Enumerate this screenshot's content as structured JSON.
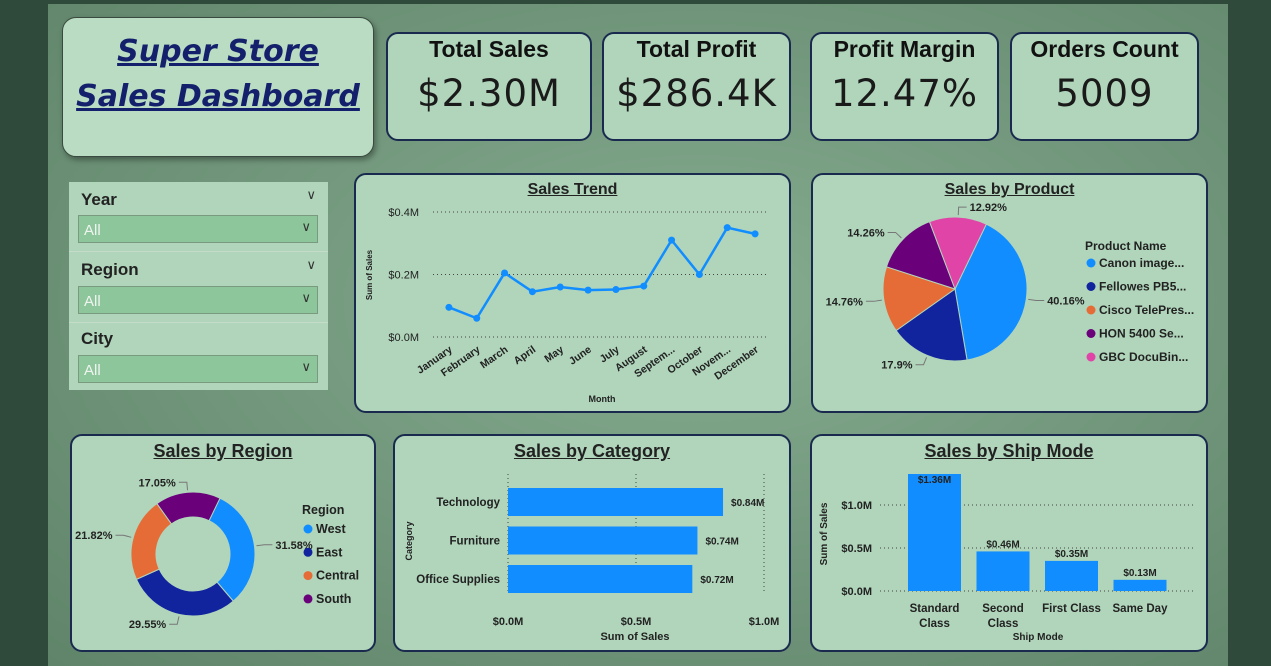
{
  "dashboard": {
    "title_line1": "Super Store ",
    "title_line2": "Sales Dashboard"
  },
  "kpis": [
    {
      "label": "Total Sales",
      "value": "$2.30M"
    },
    {
      "label": "Total Profit",
      "value": "$286.4K"
    },
    {
      "label": "Profit Margin",
      "value": "12.47%"
    },
    {
      "label": "Orders Count",
      "value": "5009"
    }
  ],
  "slicers": [
    {
      "label": "Year",
      "value": "All"
    },
    {
      "label": "Region",
      "value": "All"
    },
    {
      "label": "City",
      "value": "All"
    }
  ],
  "colors": {
    "accent": "#118dff",
    "navy": "#12239e",
    "orange": "#e66c37",
    "purple": "#6b007b",
    "pink": "#e044a7",
    "card_bg": "#b0d5bb",
    "card_border": "#1a2a4e"
  },
  "chart_data": [
    {
      "id": "sales_trend",
      "type": "line",
      "title": "Sales Trend",
      "xlabel": "Month",
      "ylabel": "Sum of Sales",
      "categories": [
        "January",
        "February",
        "March",
        "April",
        "May",
        "June",
        "July",
        "August",
        "Septem...",
        "October",
        "Novem...",
        "December"
      ],
      "values": [
        0.095,
        0.06,
        0.205,
        0.145,
        0.16,
        0.15,
        0.152,
        0.163,
        0.31,
        0.2,
        0.35,
        0.33
      ],
      "ylim": [
        0,
        0.4
      ],
      "y_ticks": [
        "$0.0M",
        "$0.2M",
        "$0.4M"
      ],
      "grid": true
    },
    {
      "id": "sales_by_product",
      "type": "pie",
      "title": "Sales by Product",
      "legend_title": "Product Name",
      "legend_position": "right",
      "slices": [
        {
          "name": "Canon image...",
          "value": 40.16,
          "label": "40.16%",
          "color": "#118dff"
        },
        {
          "name": "Fellowes PB5...",
          "value": 17.9,
          "label": "17.9%",
          "color": "#12239e"
        },
        {
          "name": "Cisco TelePres...",
          "value": 14.76,
          "label": "14.76%",
          "color": "#e66c37"
        },
        {
          "name": "HON 5400 Se...",
          "value": 14.26,
          "label": "14.26%",
          "color": "#6b007b"
        },
        {
          "name": "GBC DocuBin...",
          "value": 12.92,
          "label": "12.92%",
          "color": "#e044a7"
        }
      ]
    },
    {
      "id": "sales_by_region",
      "type": "pie",
      "title": "Sales by Region",
      "legend_title": "Region",
      "legend_position": "right",
      "donut": true,
      "slices": [
        {
          "name": "West",
          "value": 31.58,
          "label": "31.58%",
          "color": "#118dff"
        },
        {
          "name": "East",
          "value": 29.55,
          "label": "29.55%",
          "color": "#12239e"
        },
        {
          "name": "Central",
          "value": 21.82,
          "label": "21.82%",
          "color": "#e66c37"
        },
        {
          "name": "South",
          "value": 17.05,
          "label": "17.05%",
          "color": "#6b007b"
        }
      ]
    },
    {
      "id": "sales_by_category",
      "type": "bar",
      "orientation": "horizontal",
      "title": "Sales by Category",
      "xlabel": "Sum of Sales",
      "ylabel": "Category",
      "categories": [
        "Technology",
        "Furniture",
        "Office Supplies"
      ],
      "values": [
        0.84,
        0.74,
        0.72
      ],
      "data_labels": [
        "$0.84M",
        "$0.74M",
        "$0.72M"
      ],
      "xlim": [
        0,
        1.0
      ],
      "x_ticks": [
        "$0.0M",
        "$0.5M",
        "$1.0M"
      ],
      "grid": true
    },
    {
      "id": "sales_by_ship_mode",
      "type": "bar",
      "title": "Sales by Ship Mode",
      "xlabel": "Ship Mode",
      "ylabel": "Sum of Sales",
      "categories": [
        [
          "Standard",
          "Class"
        ],
        [
          "Second",
          "Class"
        ],
        [
          "First Class"
        ],
        [
          "Same Day"
        ]
      ],
      "values": [
        1.36,
        0.46,
        0.35,
        0.13
      ],
      "data_labels": [
        "$1.36M",
        "$0.46M",
        "$0.35M",
        "$0.13M"
      ],
      "ylim": [
        0,
        1.36
      ],
      "y_ticks": [
        "$0.0M",
        "$0.5M",
        "$1.0M"
      ],
      "grid": true
    }
  ]
}
